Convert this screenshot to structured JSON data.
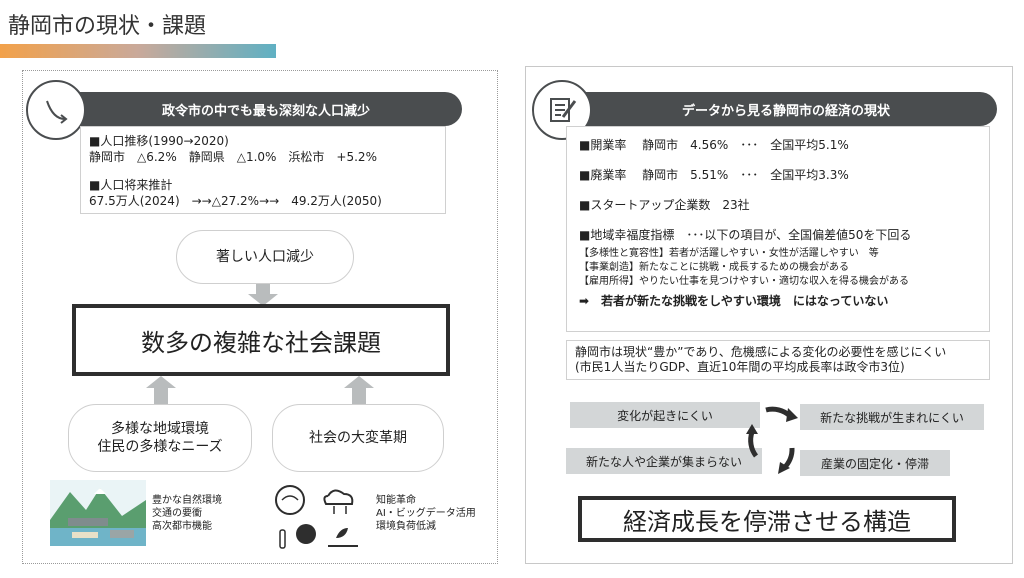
{
  "page": {
    "title": "静岡市の現状・課題"
  },
  "left": {
    "banner": "政令市の中でも最も深刻な人口減少",
    "info": {
      "line1": "■人口推移(1990→2020)",
      "line2": "静岡市　△6.2%　静岡県　△1.0%　浜松市　+5.2%",
      "line3": "■人口将来推計",
      "line4": "67.5万人(2024)　→→△27.2%→→　49.2万人(2050)"
    },
    "top_pill": "著しい人口減少",
    "main_box": "数多の複雑な社会課題",
    "pill_left_1": "多様な地域環境",
    "pill_left_2": "住民の多様なニーズ",
    "pill_right": "社会の大変革期",
    "illus_left": [
      "豊かな自然環境",
      "交通の要衝",
      "高次都市機能"
    ],
    "illus_right": [
      "知能革命",
      "AI・ビッグデータ活用",
      "環境負荷低減"
    ]
  },
  "right": {
    "banner": "データから見る静岡市の経済の現状",
    "rows": [
      "■開業率　 静岡市　4.56%　･･･　全国平均5.1%",
      "■廃業率　 静岡市　5.51%　･･･　全国平均3.3%",
      "■スタートアップ企業数　23社",
      "■地域幸福度指標　･･･以下の項目が、全国偏差値50を下回る"
    ],
    "small_rows": [
      "【多様性と寛容性】若者が活躍しやすい・女性が活躍しやすい　等",
      "【事業創造】新たなことに挑戦・成長するための機会がある",
      "【雇用所得】やりたい仕事を見つけやすい・適切な収入を得る機会がある"
    ],
    "conclusion": "➡　若者が新たな挑戦をしやすい環境　にはなっていない",
    "note_1": "静岡市は現状“豊か”であり、危機感による変化の必要性を感じにくい",
    "note_2": "(市民1人当たりGDP、直近10年間の平均成長率は政令市3位)",
    "cycle": [
      "変化が起きにくい",
      "新たな挑戦が生まれにくい",
      "産業の固定化・停滞",
      "新たな人や企業が集まらない"
    ],
    "final_box": "経済成長を停滞させる構造"
  },
  "colors": {
    "banner": "#4a4d4f",
    "cycle_box": "#d3d6d7",
    "arrow": "#b9bcbd",
    "title_bar_start": "#f2a14a",
    "title_bar_end": "#5fb0c3"
  }
}
